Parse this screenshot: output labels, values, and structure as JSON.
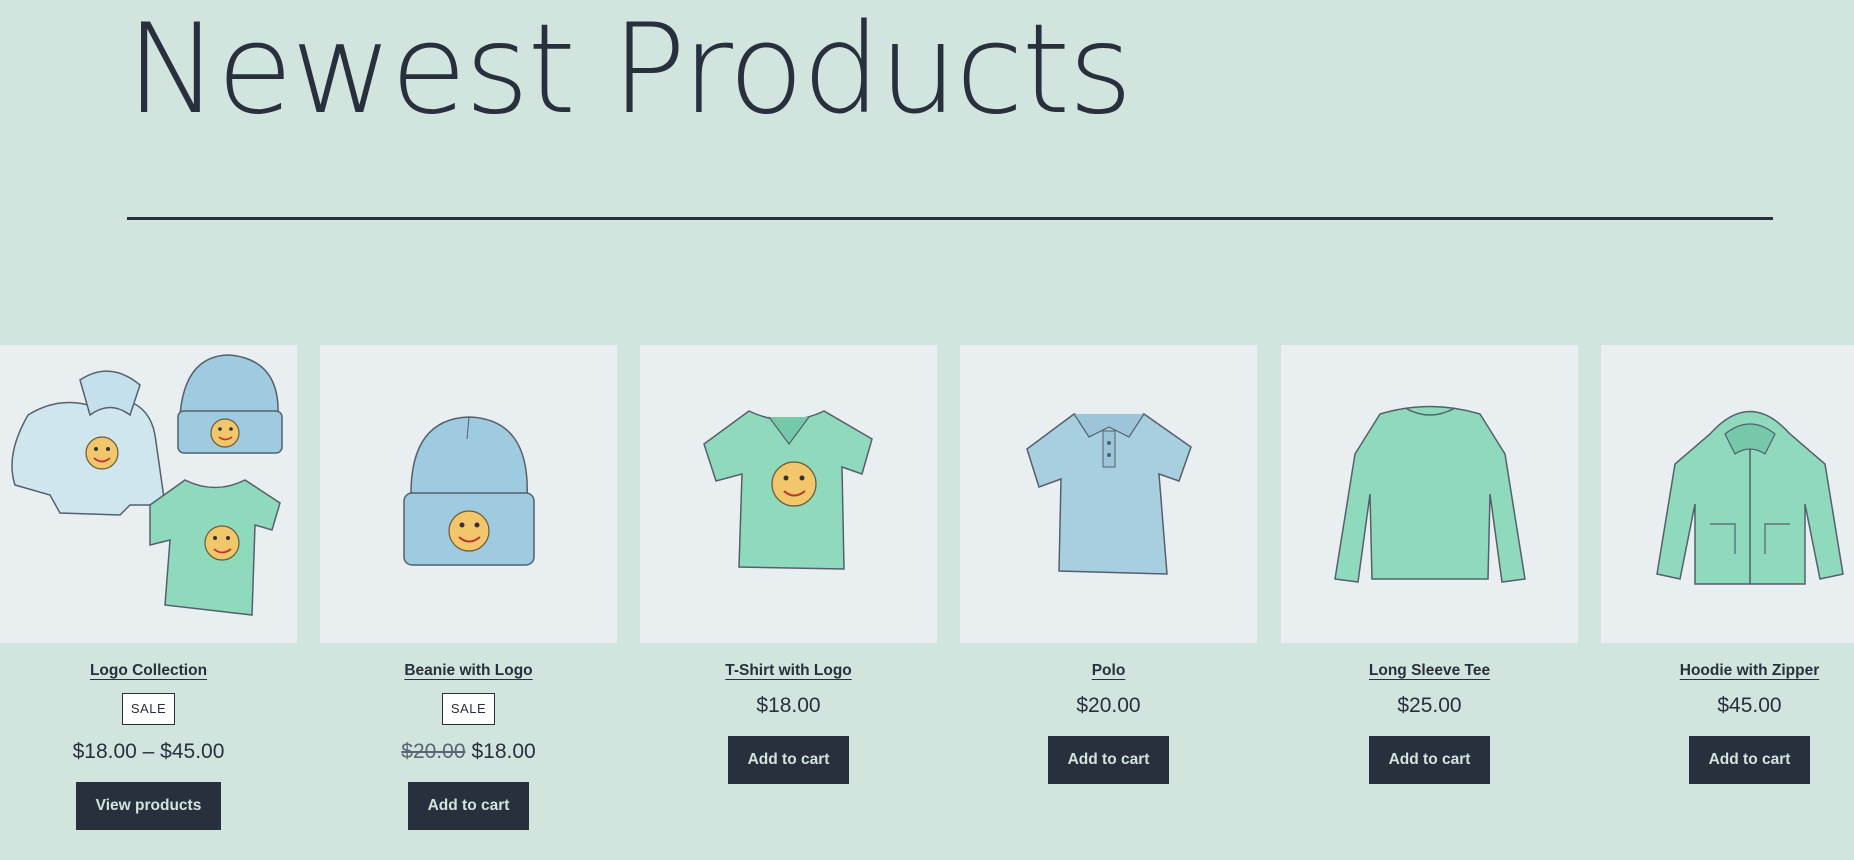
{
  "section": {
    "heading": "Newest Products"
  },
  "products": [
    {
      "title": "Logo Collection",
      "badge": "SALE",
      "price": "$18.00 – $45.00",
      "button": "View products"
    },
    {
      "title": "Beanie with Logo",
      "badge": "SALE",
      "old_price": "$20.00",
      "price": "$18.00",
      "button": "Add to cart"
    },
    {
      "title": "T-Shirt with Logo",
      "price": "$18.00",
      "button": "Add to cart"
    },
    {
      "title": "Polo",
      "price": "$20.00",
      "button": "Add to cart"
    },
    {
      "title": "Long Sleeve Tee",
      "price": "$25.00",
      "button": "Add to cart"
    },
    {
      "title": "Hoodie with Zipper",
      "price": "$45.00",
      "button": "Add to cart"
    }
  ],
  "colors": {
    "background": "#d1e4dd",
    "text": "#28303d",
    "image_background": "#e9eef1",
    "blue_garment": "#a8cfe0",
    "green_garment": "#8fd9bd",
    "emoji": "#f2c76b"
  }
}
